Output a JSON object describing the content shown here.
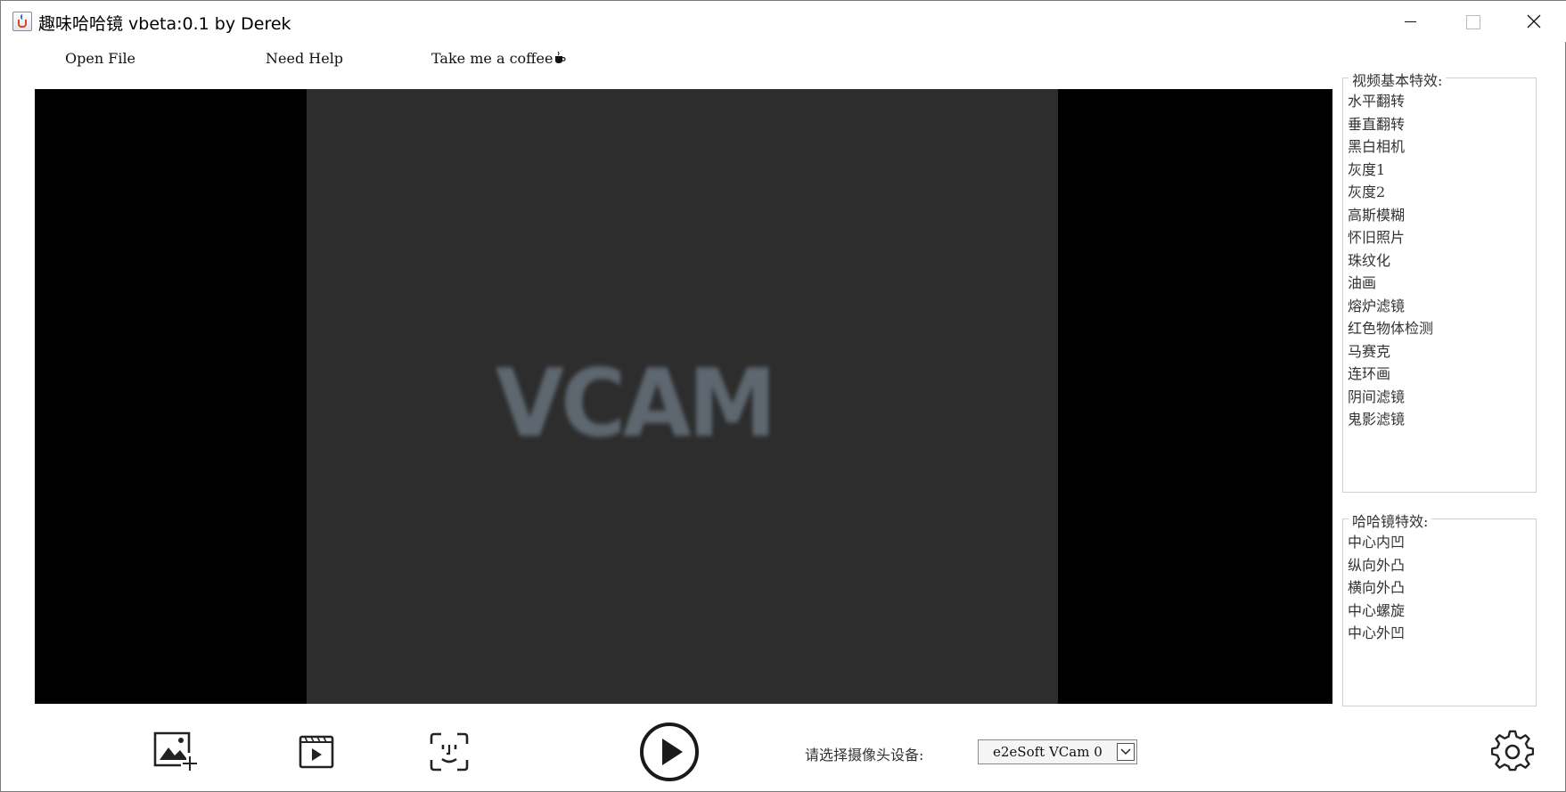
{
  "window": {
    "title": "趣味哈哈镜 vbeta:0.1 by Derek"
  },
  "menu": {
    "open_file": "Open File",
    "need_help": "Need Help",
    "coffee": "Take me a coffee",
    "coffee_icon": "coffee-cup-icon"
  },
  "video": {
    "overlay_text": "VCAM",
    "colors": {
      "letterbox": "#000000",
      "frame": "#2d2d2d",
      "text": "#5e6770"
    }
  },
  "basic_effects": {
    "legend": "视频基本特效:",
    "items": [
      "水平翻转",
      "垂直翻转",
      "黑白相机",
      "灰度1",
      "灰度2",
      "高斯模糊",
      "怀旧照片",
      "珠纹化",
      "油画",
      "熔炉滤镜",
      "红色物体检测",
      "马赛克",
      "连环画",
      "阴间滤镜",
      "鬼影滤镜"
    ]
  },
  "haha_effects": {
    "legend": "哈哈镜特效:",
    "items": [
      "中心内凹",
      "纵向外凸",
      "横向外凸",
      "中心螺旋",
      "中心外凹"
    ]
  },
  "toolbar": {
    "icons": [
      "add-image-icon",
      "video-file-icon",
      "face-scan-icon",
      "play-icon",
      "settings-gear-icon"
    ],
    "camera_label": "请选择摄像头设备:",
    "camera_selected": "e2eSoft VCam 0"
  }
}
